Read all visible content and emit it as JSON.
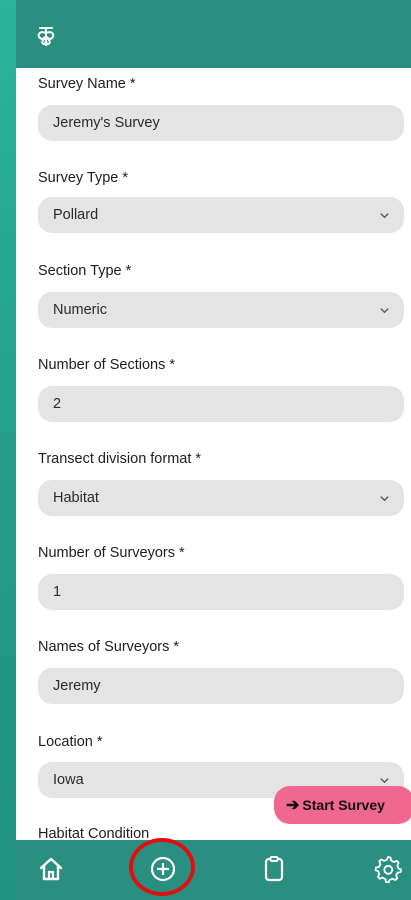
{
  "fields": [
    {
      "label": "Survey Name *",
      "value": "Jeremy's Survey",
      "dropdown": false
    },
    {
      "label": "Survey Type *",
      "value": "Pollard",
      "dropdown": true
    },
    {
      "label": "Section Type *",
      "value": "Numeric",
      "dropdown": true
    },
    {
      "label": "Number of Sections *",
      "value": "2",
      "dropdown": false
    },
    {
      "label": "Transect division format *",
      "value": "Habitat",
      "dropdown": true
    },
    {
      "label": "Number of Surveyors *",
      "value": "1",
      "dropdown": false
    },
    {
      "label": "Names of Surveyors *",
      "value": "Jeremy",
      "dropdown": false
    },
    {
      "label": "Location *",
      "value": "Iowa",
      "dropdown": true
    },
    {
      "label": "Habitat Condition",
      "value": "",
      "dropdown": false
    }
  ],
  "start_button": {
    "label": "Start Survey"
  },
  "nav": {
    "items": [
      "home-icon",
      "add-circle-icon",
      "clipboard-icon",
      "gear-icon"
    ]
  },
  "colors": {
    "bar": "#2a8f80",
    "field_bg": "#e4e4e4",
    "start_button": "#f0678f",
    "highlight": "#e01010"
  }
}
